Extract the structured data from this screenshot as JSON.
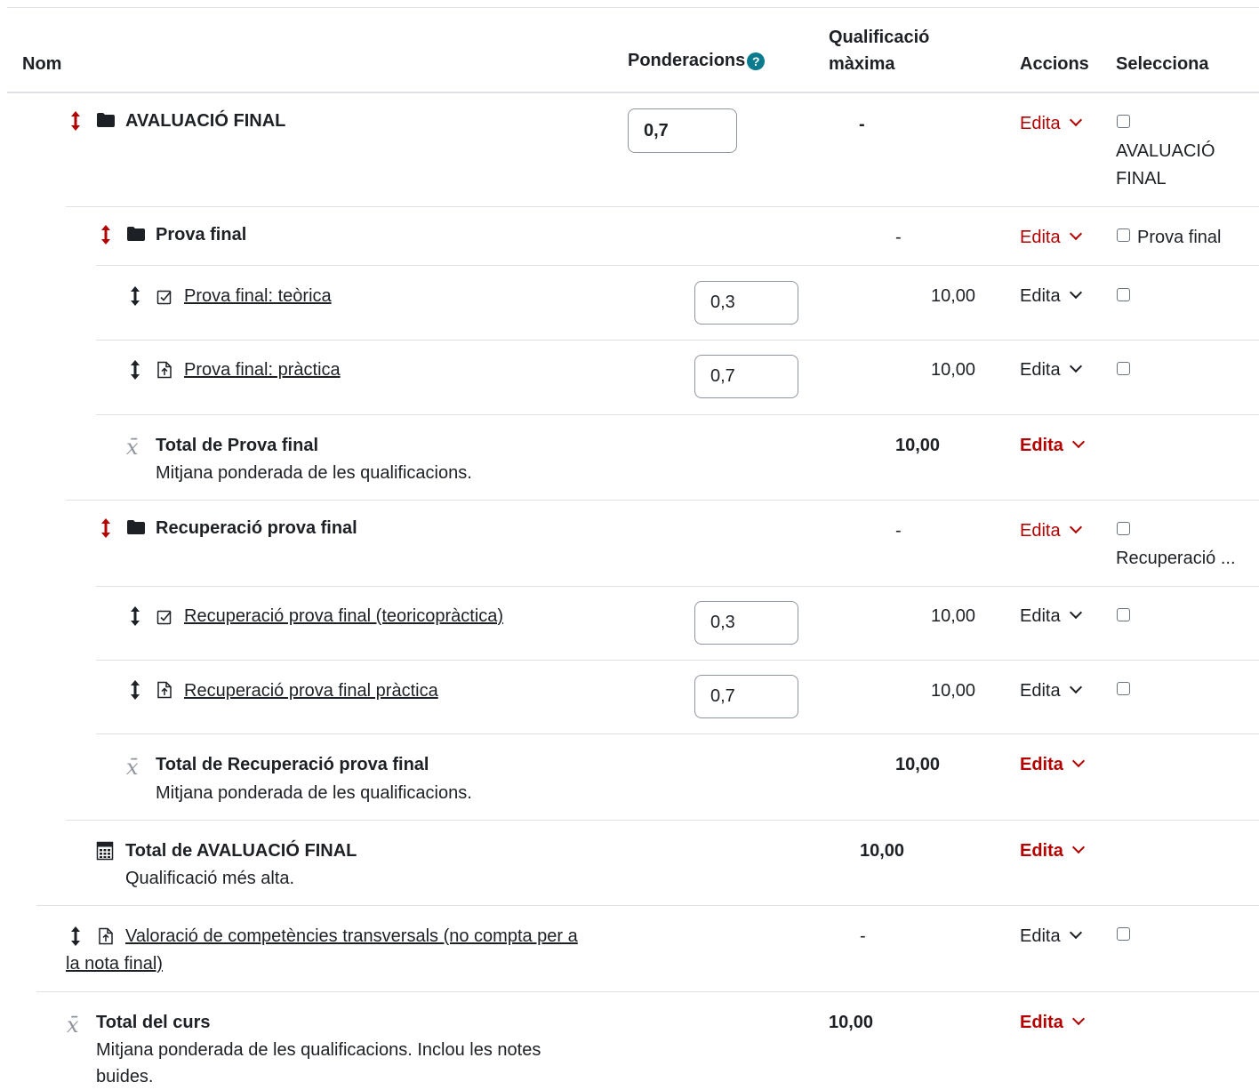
{
  "headers": {
    "name": "Nom",
    "weights": "Ponderacions",
    "max_grade_line1": "Qualificació",
    "max_grade_line2": "màxima",
    "actions": "Accions",
    "select": "Selecciona"
  },
  "rows": {
    "avaluacio": {
      "name": "AVALUACIÓ FINAL",
      "weight": "0,7",
      "max": "-",
      "edit": "Edita",
      "select_line1": "AVALUACIÓ",
      "select_line2": "FINAL"
    },
    "prova_final": {
      "name": "Prova final",
      "max": "-",
      "edit": "Edita",
      "select": "Prova final"
    },
    "teorica": {
      "name": "Prova final: teòrica",
      "weight": "0,3",
      "max": "10,00",
      "edit": "Edita"
    },
    "practica": {
      "name": "Prova final: pràctica",
      "weight": "0,7",
      "max": "10,00",
      "edit": "Edita"
    },
    "total_prova": {
      "name": "Total de Prova final",
      "desc": "Mitjana ponderada de les qualificacions.",
      "max": "10,00",
      "edit": "Edita"
    },
    "recuperacio": {
      "name": "Recuperació prova final",
      "max": "-",
      "edit": "Edita",
      "select": "Recuperació ..."
    },
    "rec_teorica": {
      "name": "Recuperació prova final (teoricopràctica)",
      "weight": "0,3",
      "max": "10,00",
      "edit": "Edita"
    },
    "rec_practica": {
      "name": "Recuperació prova final pràctica",
      "weight": "0,7",
      "max": "10,00",
      "edit": "Edita"
    },
    "total_rec": {
      "name": "Total de Recuperació prova final",
      "desc": "Mitjana ponderada de les qualificacions.",
      "max": "10,00",
      "edit": "Edita"
    },
    "total_aval": {
      "name": "Total de AVALUACIÓ FINAL",
      "desc": "Qualificació més alta.",
      "max": "10,00",
      "edit": "Edita"
    },
    "valoracio": {
      "name_line1": "Valoració de competències transversals (no compta per a",
      "name_line2": "la nota final)",
      "max": "-",
      "edit": "Edita"
    },
    "total_curs": {
      "name": "Total del curs",
      "desc_line1": "Mitjana ponderada de les qualificacions. Inclou les notes",
      "desc_line2": "buides.",
      "max": "10,00",
      "edit": "Edita"
    }
  },
  "colors": {
    "accent_red": "#b30000",
    "help_icon": "#0a7a8f",
    "border": "#dee2e6"
  }
}
